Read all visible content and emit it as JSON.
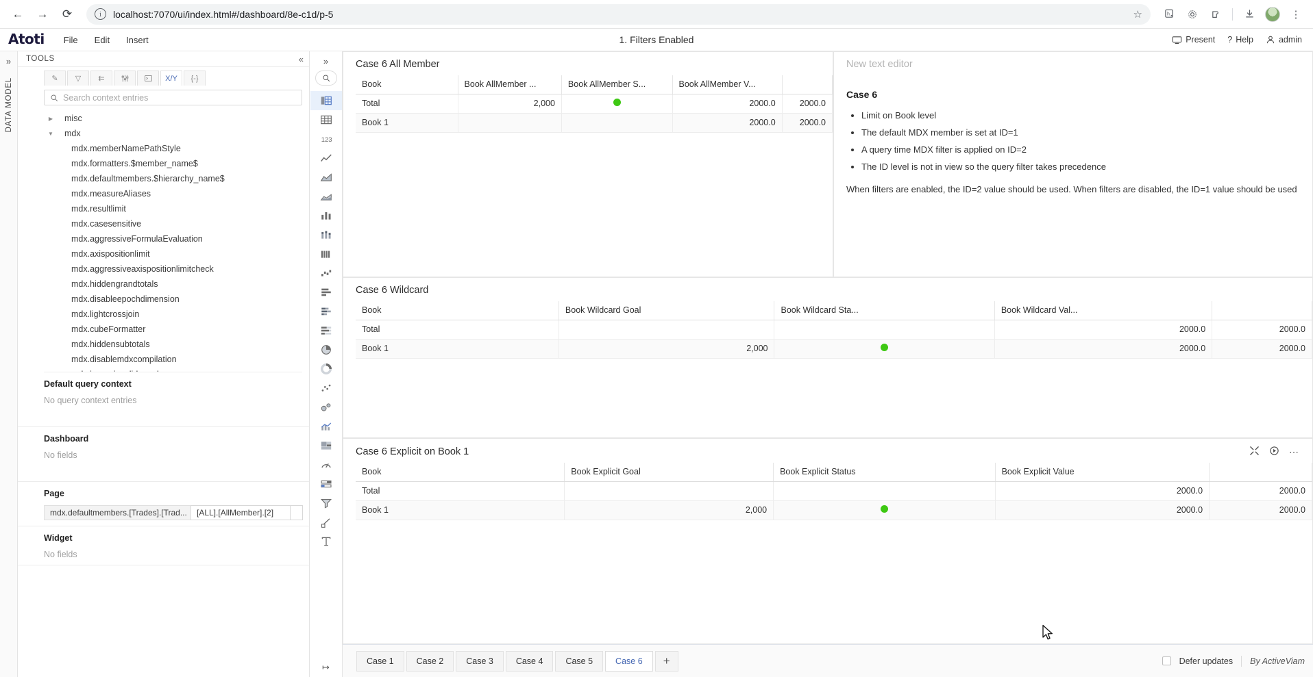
{
  "browser": {
    "back_icon": "arrow-left-icon",
    "forward_icon": "arrow-right-icon",
    "reload_icon": "reload-icon",
    "site_info_icon": "info-icon",
    "url": "localhost:7070/ui/index.html#/dashboard/8e-c1d/p-5",
    "bookmark_icon": "star-icon",
    "toolbar_icons": [
      "hypothesis-icon",
      "gear-icon",
      "extensions-icon",
      "download-icon"
    ],
    "avatar": "profile-avatar",
    "menu_icon": "kebab-menu-icon"
  },
  "app": {
    "brand": "Atoti",
    "menus": [
      "File",
      "Edit",
      "Insert"
    ],
    "title": "1. Filters Enabled",
    "right_actions": [
      {
        "label": "Present",
        "icon": "monitor-icon"
      },
      {
        "label": "Help",
        "icon": "question-icon"
      },
      {
        "label": "admin",
        "icon": "user-icon"
      }
    ]
  },
  "left_rail": {
    "expand_icon": "chevrons-right-icon",
    "label": "DATA MODEL"
  },
  "tools": {
    "header": "TOOLS",
    "collapse_icon": "chevrons-left-icon",
    "tabs": [
      {
        "name": "pencil-icon",
        "glyph": "✎",
        "active": false
      },
      {
        "name": "filter-icon",
        "glyph": "▽",
        "active": false
      },
      {
        "name": "hierarchy-icon",
        "glyph": "⑂",
        "active": false
      },
      {
        "name": "sliders-icon",
        "glyph": "⩝",
        "active": false
      },
      {
        "name": "console-icon",
        "glyph": "⌨",
        "active": false
      },
      {
        "name": "xy-icon",
        "glyph": "X/Y",
        "active": true
      },
      {
        "name": "braces-icon",
        "glyph": "{-}",
        "active": false
      }
    ],
    "search_placeholder": "Search context entries",
    "search_value": "",
    "search_icon": "search-icon",
    "tree": [
      {
        "label": "misc",
        "type": "group",
        "expanded": false
      },
      {
        "label": "mdx",
        "type": "group",
        "expanded": true
      },
      {
        "label": "mdx.memberNamePathStyle",
        "type": "child"
      },
      {
        "label": "mdx.formatters.$member_name$",
        "type": "child"
      },
      {
        "label": "mdx.defaultmembers.$hierarchy_name$",
        "type": "child"
      },
      {
        "label": "mdx.measureAliases",
        "type": "child"
      },
      {
        "label": "mdx.resultlimit",
        "type": "child"
      },
      {
        "label": "mdx.casesensitive",
        "type": "child"
      },
      {
        "label": "mdx.aggressiveFormulaEvaluation",
        "type": "child"
      },
      {
        "label": "mdx.axispositionlimit",
        "type": "child"
      },
      {
        "label": "mdx.aggressiveaxispositionlimitcheck",
        "type": "child"
      },
      {
        "label": "mdx.hiddengrandtotals",
        "type": "child"
      },
      {
        "label": "mdx.disableepochdimension",
        "type": "child"
      },
      {
        "label": "mdx.lightcrossjoin",
        "type": "child"
      },
      {
        "label": "mdx.cubeFormatter",
        "type": "child"
      },
      {
        "label": "mdx.hiddensubtotals",
        "type": "child"
      },
      {
        "label": "mdx.disablemdxcompilation",
        "type": "child"
      },
      {
        "label": "mdx.ignoreinvalidmembers",
        "type": "child"
      }
    ],
    "sections": [
      {
        "title": "Default query context",
        "empty": "No query context entries"
      },
      {
        "title": "Dashboard",
        "empty": "No fields"
      }
    ],
    "page_section": {
      "title": "Page",
      "filter_key": "mdx.defaultmembers.[Trades].[Trad...",
      "filter_value": "[ALL].[AllMember].[2]"
    },
    "widget_section": {
      "title": "Widget",
      "empty": "No fields"
    }
  },
  "palette": {
    "expand_icon": "chevrons-right-icon",
    "search_icon": "search-icon",
    "collapse_icon": "collapse-panel-icon",
    "items": [
      {
        "name": "pivot-table-icon",
        "selected": true
      },
      {
        "name": "table-icon",
        "selected": false
      },
      {
        "name": "kpi-number-icon",
        "selected": false
      },
      {
        "name": "line-chart-icon",
        "selected": false
      },
      {
        "name": "area-chart-icon",
        "selected": false
      },
      {
        "name": "stacked-area-chart-icon",
        "selected": false
      },
      {
        "name": "column-chart-icon",
        "selected": false
      },
      {
        "name": "stacked-column-chart-icon",
        "selected": false
      },
      {
        "name": "histogram-icon",
        "selected": false
      },
      {
        "name": "waterfall-chart-icon",
        "selected": false
      },
      {
        "name": "bar-chart-icon",
        "selected": false
      },
      {
        "name": "stacked-bar-chart-icon",
        "selected": false
      },
      {
        "name": "bar-list-icon",
        "selected": false
      },
      {
        "name": "pie-chart-icon",
        "selected": false
      },
      {
        "name": "donut-chart-icon",
        "selected": false
      },
      {
        "name": "scatter-plot-icon",
        "selected": false
      },
      {
        "name": "bubble-chart-icon",
        "selected": false
      },
      {
        "name": "combo-chart-icon",
        "selected": false
      },
      {
        "name": "tree-map-icon",
        "selected": false
      },
      {
        "name": "gauge-icon",
        "selected": false
      },
      {
        "name": "slicer-icon",
        "selected": false
      },
      {
        "name": "filter-widget-icon",
        "selected": false
      },
      {
        "name": "shape-icon",
        "selected": false
      },
      {
        "name": "text-editor-icon",
        "selected": false
      }
    ]
  },
  "widgets": {
    "all_member": {
      "title": "Case 6 All Member",
      "columns": [
        "Book",
        "Book AllMember ...",
        "Book AllMember S...",
        "Book AllMember V...",
        ""
      ],
      "rows": [
        {
          "cells": [
            "Total",
            "2,000",
            "●",
            "2000.0",
            "2000.0"
          ]
        },
        {
          "cells": [
            "Book 1",
            "",
            "",
            "2000.0",
            "2000.0"
          ]
        }
      ]
    },
    "wildcard": {
      "title": "Case 6 Wildcard",
      "columns": [
        "Book",
        "Book Wildcard Goal",
        "Book Wildcard Sta...",
        "Book Wildcard Val...",
        ""
      ],
      "rows": [
        {
          "cells": [
            "Total",
            "",
            "",
            "2000.0",
            "2000.0"
          ]
        },
        {
          "cells": [
            "Book 1",
            "2,000",
            "●",
            "2000.0",
            "2000.0"
          ]
        }
      ]
    },
    "explicit": {
      "title": "Case 6 Explicit on Book 1",
      "columns": [
        "Book",
        "Book Explicit Goal",
        "Book Explicit Status",
        "Book Explicit Value",
        ""
      ],
      "rows": [
        {
          "cells": [
            "Total",
            "",
            "",
            "2000.0",
            "2000.0"
          ]
        },
        {
          "cells": [
            "Book 1",
            "2,000",
            "●",
            "2000.0",
            "2000.0"
          ]
        }
      ],
      "tools": [
        {
          "name": "fullscreen-icon",
          "glyph": "⤢"
        },
        {
          "name": "play-icon",
          "glyph": "▷"
        },
        {
          "name": "more-options-icon",
          "glyph": "⋯"
        }
      ]
    },
    "text_editor": {
      "placeholder": "New text editor",
      "heading": "Case 6",
      "bullets": [
        "Limit on Book level",
        "The default MDX member is set at ID=1",
        "A query time MDX filter is applied on ID=2",
        "The ID level is not in view so the query filter takes precedence"
      ],
      "paragraph": "When filters are enabled, the ID=2 value should be used. When filters are disabled, the ID=1 value should be used"
    }
  },
  "tabbar": {
    "tabs": [
      "Case 1",
      "Case 2",
      "Case 3",
      "Case 4",
      "Case 5",
      "Case 6"
    ],
    "active_index": 5,
    "add_label": "+",
    "defer_label": "Defer updates",
    "defer_checked": false,
    "byline": "By ActiveViam"
  },
  "colors": {
    "status_dot": "#3ec813",
    "accent": "#4668b3",
    "brand": "#1d1a3d"
  }
}
